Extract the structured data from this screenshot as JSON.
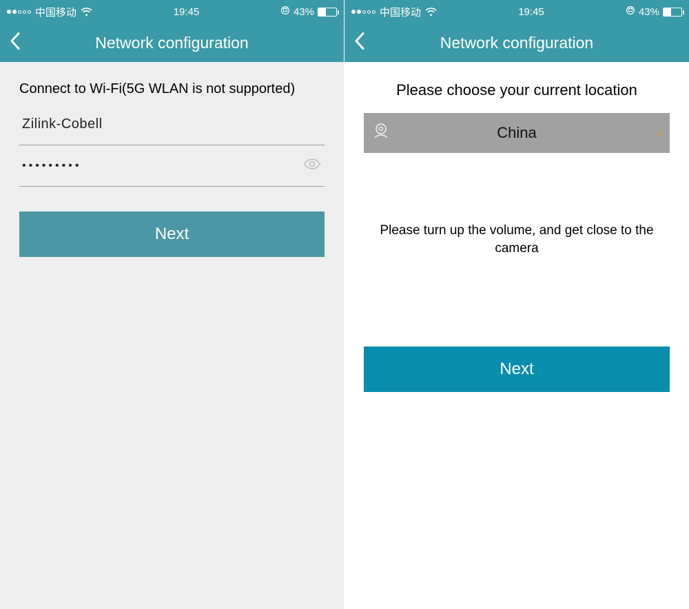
{
  "status": {
    "carrier": "中国移动",
    "time": "19:45",
    "battery_pct": "43%",
    "battery_fill_pct": 43
  },
  "nav": {
    "title": "Network configuration"
  },
  "left": {
    "instruction": "Connect to Wi-Fi(5G WLAN is not supported)",
    "ssid_value": "Zilink-Cobell",
    "password_value": "•••••••••",
    "next_label": "Next"
  },
  "right": {
    "heading": "Please choose your current location",
    "location_value": "China",
    "hint": "Please turn up the volume, and get close to the camera",
    "next_label": "Next"
  }
}
